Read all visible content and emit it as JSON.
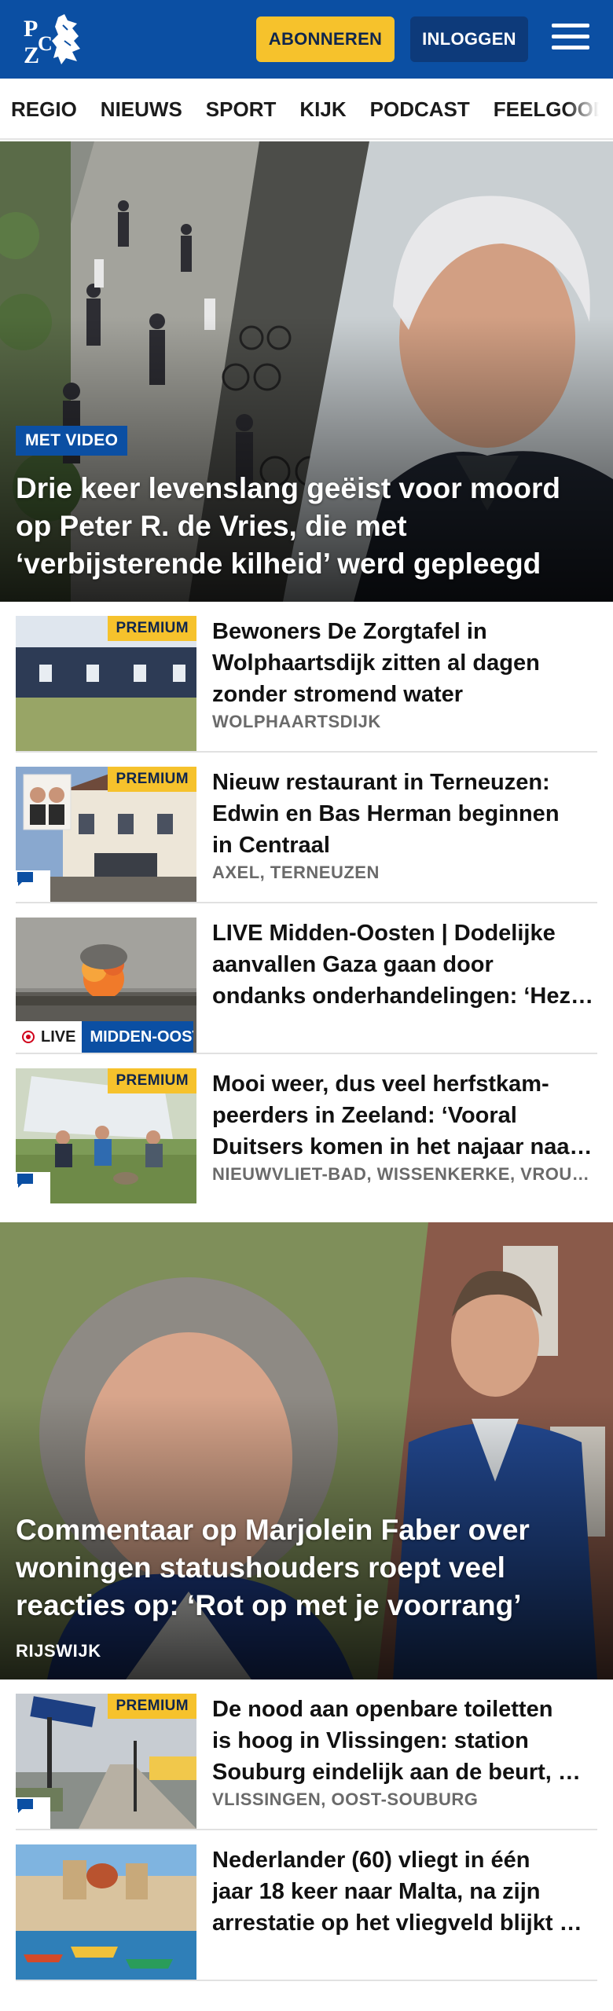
{
  "header": {
    "logo_text": "PZC",
    "subscribe_label": "ABONNEREN",
    "login_label": "INLOGGEN",
    "brand_color": "#0b4fa3",
    "accent_color": "#f6c22c"
  },
  "nav": {
    "items": [
      "REGIO",
      "NIEUWS",
      "SPORT",
      "KIJK",
      "PODCAST",
      "FEELGOOD"
    ]
  },
  "hero1": {
    "badge": "MET VIDEO",
    "title": "Drie keer levenslang geëist voor moord op Peter R. de Vries, die met ‘verbijsterende kilheid’ werd gepleegd"
  },
  "articles": [
    {
      "premium": "PREMIUM",
      "title_lines": [
        "Bewoners De Zorgtafel in",
        "Wolphaartsdijk zitten al dagen",
        "zonder stromend water"
      ],
      "location": "WOLPHAARTSDIJK",
      "comments_icon": false
    },
    {
      "premium": "PREMIUM",
      "title_lines": [
        "Nieuw restaurant in Terneuzen:",
        "Edwin en Bas Herman beginnen",
        "in Centraal"
      ],
      "location": "AXEL, TERNEUZEN",
      "comments_icon": true
    },
    {
      "live_label": "LIVE",
      "category": "MIDDEN-OOSTEN",
      "title_lines": [
        "LIVE Midden-Oosten | Dodelijke",
        "aanvallen Gaza gaan door",
        "ondanks onderhandelingen: ‘Hezbollah"
      ],
      "location": ""
    },
    {
      "premium": "PREMIUM",
      "title_lines": [
        "Mooi weer, dus veel herfstkam-",
        "peerders in Zeeland: ‘Vooral",
        "Duitsers komen in het najaar naar de kust’"
      ],
      "location": "NIEUWVLIET-BAD, WISSENKERKE, VROUWENPOLDER",
      "comments_icon": true
    }
  ],
  "hero2": {
    "title": "Commentaar op Marjolein Faber over woningen statushouders roept veel reacties op: ‘Rot op met je voorrang’",
    "location": "RIJSWIJK"
  },
  "articles2": [
    {
      "premium": "PREMIUM",
      "title_lines": [
        "De nood aan openbare toiletten",
        "is hoog in Vlissingen: station",
        "Souburg eindelijk aan de beurt, maar nog niet voor de zomer"
      ],
      "location": "VLISSINGEN, OOST-SOUBURG",
      "comments_icon": true
    },
    {
      "title_lines": [
        "Nederlander (60) vliegt in één",
        "jaar 18 keer naar Malta, na zijn",
        "arrestatie op het vliegveld blijkt waarom"
      ],
      "location": ""
    }
  ]
}
